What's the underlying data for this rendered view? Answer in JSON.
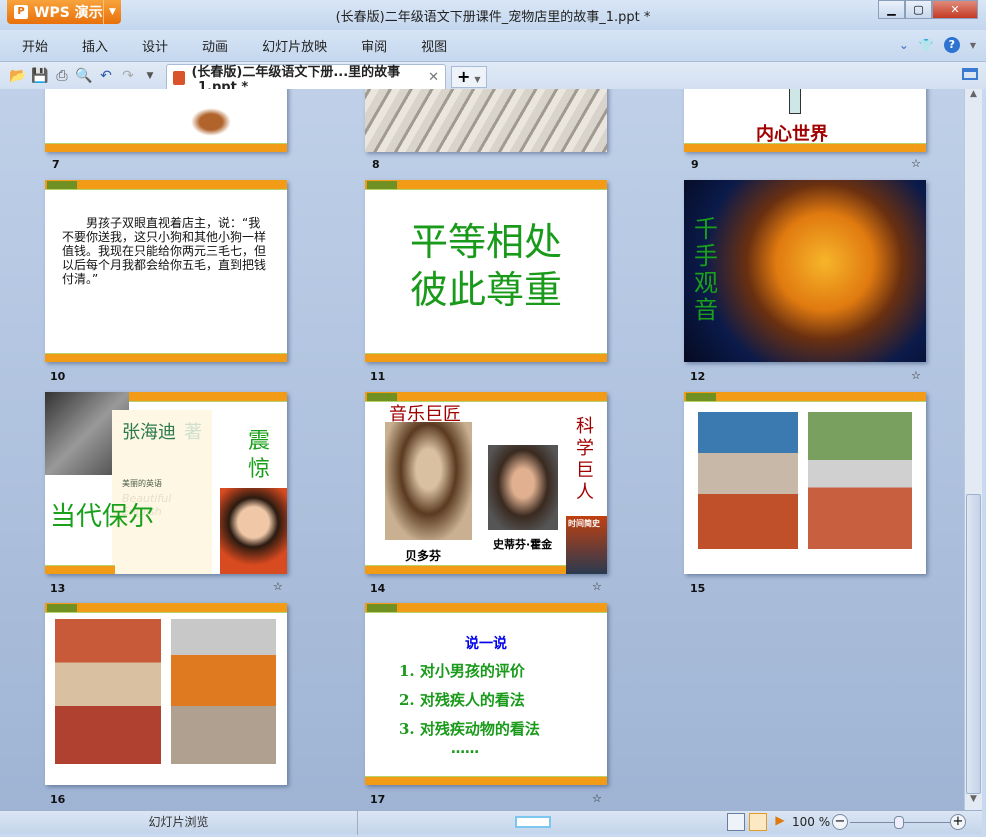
{
  "app": {
    "name": "WPS 演示",
    "title": "(长春版)二年级语文下册课件_宠物店里的故事_1.ppt *"
  },
  "menu": [
    "开始",
    "插入",
    "设计",
    "动画",
    "幻灯片放映",
    "审阅",
    "视图"
  ],
  "tab": {
    "label": "(长春版)二年级语文下册...里的故事_1.ppt *"
  },
  "slides": [
    {
      "number": "7"
    },
    {
      "number": "8"
    },
    {
      "number": "9",
      "title": "内心世界"
    },
    {
      "number": "10",
      "text": "男孩子双眼直视着店主，说：“我不要你送我，这只小狗和其他小狗一样值钱。我现在只能给你两元三毛七，但以后每个月我都会给你五毛，直到把钱付清。”"
    },
    {
      "number": "11",
      "line1": "平等相处",
      "line2": "彼此尊重"
    },
    {
      "number": "12",
      "title": "千手观音"
    },
    {
      "number": "13",
      "author": "张海迪",
      "author_suffix": "著",
      "book": "美丽的英语",
      "book_en": "Beautiful English",
      "title": "当代保尔",
      "side": "震惊"
    },
    {
      "number": "14",
      "left_title": "音乐巨匠",
      "right_title": "科学巨人",
      "caption1": "贝多芬",
      "caption2": "史蒂芬·霍金",
      "book": "时间简史"
    },
    {
      "number": "15"
    },
    {
      "number": "16"
    },
    {
      "number": "17",
      "heading": "说一说",
      "items": [
        "1. 对小男孩的评价",
        "2. 对残疾人的看法",
        "3. 对残疾动物的看法"
      ],
      "ellipsis": "……"
    }
  ],
  "status": {
    "view_label": "幻灯片浏览",
    "zoom": "100 %"
  },
  "colors": {
    "orange": "#f29b17",
    "green": "#1a9a1a",
    "red": "#a00000",
    "blue": "#0000ee"
  }
}
